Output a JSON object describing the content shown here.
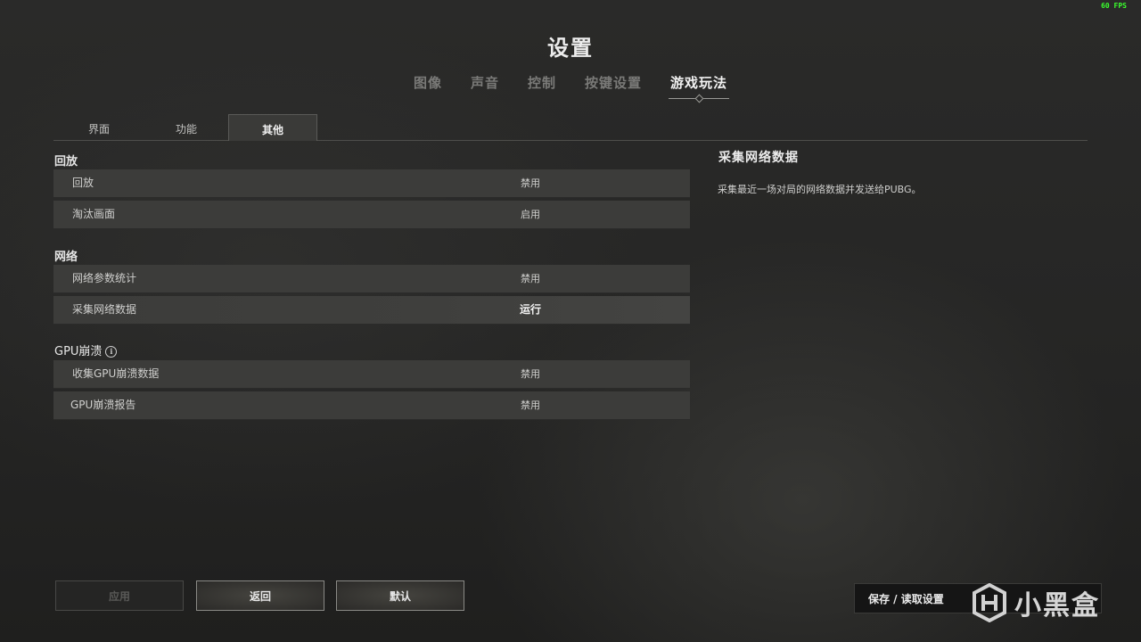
{
  "overlay": {
    "fps": "60 FPS"
  },
  "header": {
    "title": "设置"
  },
  "main_tabs": [
    {
      "label": "图像",
      "active": false
    },
    {
      "label": "声音",
      "active": false
    },
    {
      "label": "控制",
      "active": false
    },
    {
      "label": "按键设置",
      "active": false
    },
    {
      "label": "游戏玩法",
      "active": true
    }
  ],
  "sub_tabs": [
    {
      "label": "界面",
      "active": false
    },
    {
      "label": "功能",
      "active": false
    },
    {
      "label": "其他",
      "active": true
    }
  ],
  "sections": [
    {
      "title": "回放",
      "has_info": false,
      "rows": [
        {
          "label": "回放",
          "value": "禁用"
        },
        {
          "label": "淘汰画面",
          "value": "启用"
        }
      ]
    },
    {
      "title": "网络",
      "has_info": false,
      "rows": [
        {
          "label": "网络参数统计",
          "value": "禁用"
        },
        {
          "label": "采集网络数据",
          "value": "运行"
        }
      ]
    },
    {
      "title": "GPU崩溃",
      "has_info": true,
      "info_glyph": "i",
      "rows": [
        {
          "label": "收集GPU崩溃数据",
          "value": "禁用"
        },
        {
          "label": "GPU崩溃报告",
          "value": "禁用"
        }
      ]
    }
  ],
  "description": {
    "title": "采集网络数据",
    "text": "采集最近一场对局的网络数据并发送给PUBG。"
  },
  "footer": {
    "apply_label": "应用",
    "back_label": "返回",
    "default_label": "默认",
    "save_load_label": "保存 / 读取设置"
  },
  "watermark": {
    "text": "小黑盒",
    "icon": "xiaoheihe-logo-icon"
  },
  "colors": {
    "fps": "#3bff2e",
    "row_bg": "#3c3c3a",
    "accent_border": "#8a8a86"
  }
}
